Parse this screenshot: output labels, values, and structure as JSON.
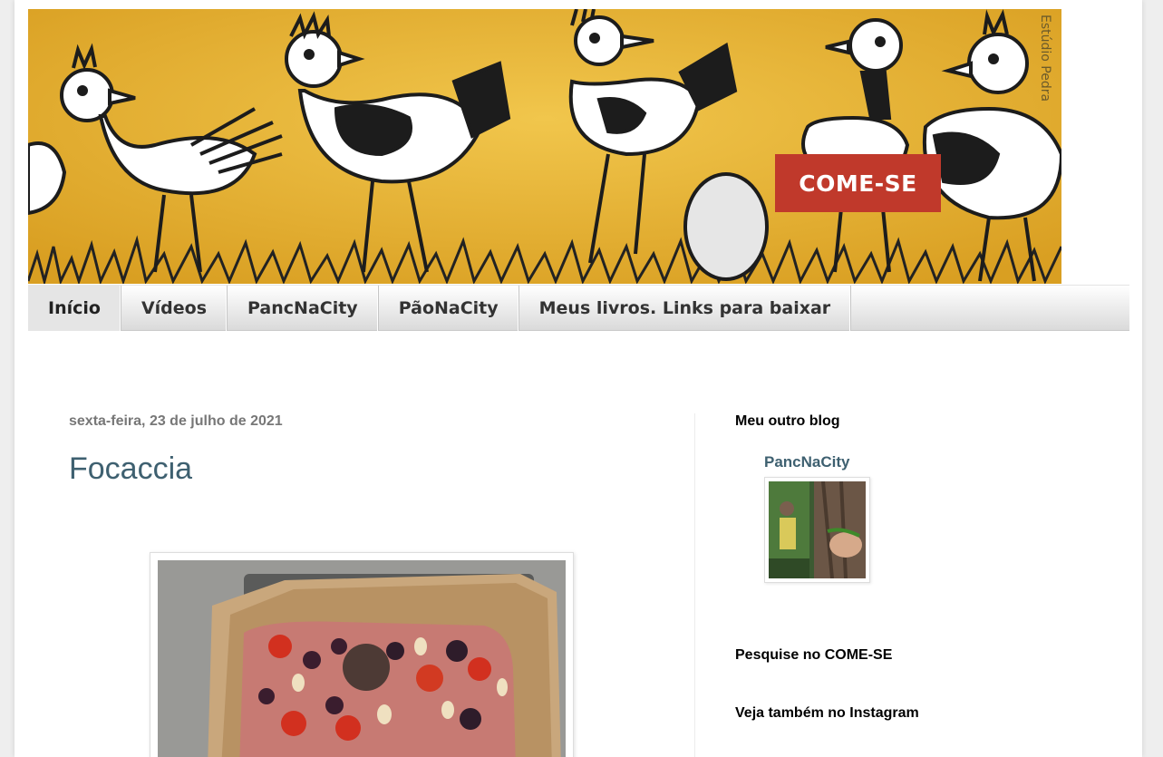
{
  "header": {
    "banner_credit": "Estúdio Pedra",
    "logo_text": "COME-SE"
  },
  "nav": {
    "tabs": [
      {
        "label": "Início",
        "active": true
      },
      {
        "label": "Vídeos",
        "active": false
      },
      {
        "label": "PancNaCity",
        "active": false
      },
      {
        "label": "PãoNaCity",
        "active": false
      },
      {
        "label": "Meus livros. Links para baixar",
        "active": false
      }
    ]
  },
  "post": {
    "date": "sexta-feira, 23 de julho de 2021",
    "title": "Focaccia"
  },
  "sidebar": {
    "other_blog": {
      "title": "Meu outro blog",
      "link_text": "PancNaCity"
    },
    "search_title": "Pesquise no COME-SE",
    "instagram_title": "Veja também no Instagram"
  },
  "colors": {
    "banner_yellow": "#e8b432",
    "logo_red": "#c0392b",
    "title_blue": "#3e6070"
  }
}
